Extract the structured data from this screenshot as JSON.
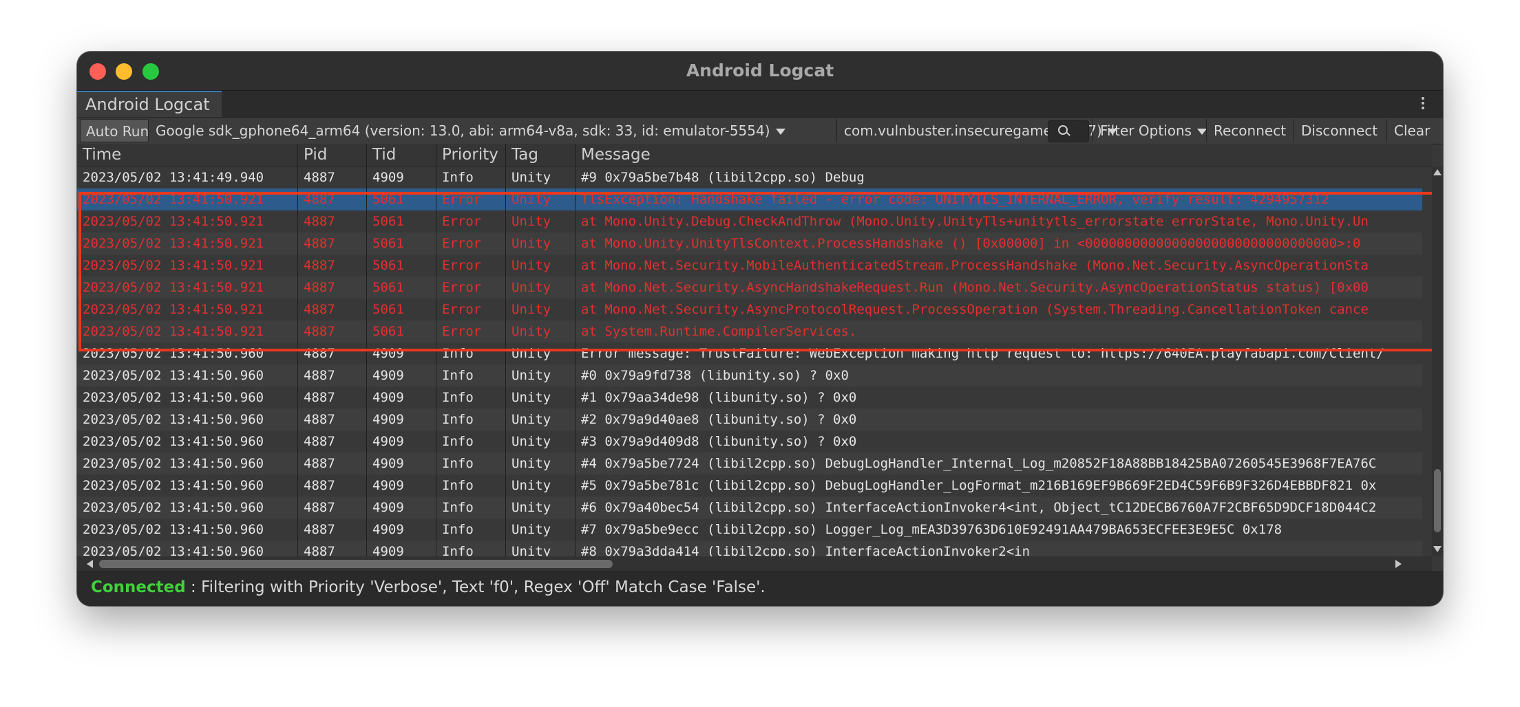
{
  "window": {
    "title": "Android Logcat",
    "tab_label": "Android Logcat"
  },
  "toolbar": {
    "auto_run": "Auto Run",
    "device": "Google sdk_gphone64_arm64 (version: 13.0, abi: arm64-v8a, sdk: 33, id: emulator-5554)",
    "package": "com.vulnbuster.insecuregame (4887)",
    "search_value": "",
    "filter_options": "Filter Options",
    "reconnect": "Reconnect",
    "disconnect": "Disconnect",
    "clear": "Clear"
  },
  "columns": [
    "Time",
    "Pid",
    "Tid",
    "Priority",
    "Tag",
    "Message"
  ],
  "rows": [
    {
      "time": "2023/05/02 13:41:49.940",
      "pid": "4887",
      "tid": "4909",
      "priority": "Info",
      "tag": "Unity",
      "message": " #9 0x79a5be7b48 (libil2cpp.so) Debug",
      "level": "info"
    },
    {
      "time": "2023/05/02 13:41:50.921",
      "pid": "4887",
      "tid": "5061",
      "priority": "Error",
      "tag": "Unity",
      "message": "TlsException: Handshake failed - error code: UNITYTLS_INTERNAL_ERROR, verify result: 4294957312",
      "level": "error",
      "selected": true
    },
    {
      "time": "2023/05/02 13:41:50.921",
      "pid": "4887",
      "tid": "5061",
      "priority": "Error",
      "tag": "Unity",
      "message": "  at Mono.Unity.Debug.CheckAndThrow (Mono.Unity.UnityTls+unitytls_errorstate errorState, Mono.Unity.Un",
      "level": "error"
    },
    {
      "time": "2023/05/02 13:41:50.921",
      "pid": "4887",
      "tid": "5061",
      "priority": "Error",
      "tag": "Unity",
      "message": "  at Mono.Unity.UnityTlsContext.ProcessHandshake () [0x00000] in <00000000000000000000000000000000>:0",
      "level": "error"
    },
    {
      "time": "2023/05/02 13:41:50.921",
      "pid": "4887",
      "tid": "5061",
      "priority": "Error",
      "tag": "Unity",
      "message": "  at Mono.Net.Security.MobileAuthenticatedStream.ProcessHandshake (Mono.Net.Security.AsyncOperationSta",
      "level": "error"
    },
    {
      "time": "2023/05/02 13:41:50.921",
      "pid": "4887",
      "tid": "5061",
      "priority": "Error",
      "tag": "Unity",
      "message": "  at Mono.Net.Security.AsyncHandshakeRequest.Run (Mono.Net.Security.AsyncOperationStatus status) [0x00",
      "level": "error"
    },
    {
      "time": "2023/05/02 13:41:50.921",
      "pid": "4887",
      "tid": "5061",
      "priority": "Error",
      "tag": "Unity",
      "message": "  at Mono.Net.Security.AsyncProtocolRequest.ProcessOperation (System.Threading.CancellationToken cance",
      "level": "error"
    },
    {
      "time": "2023/05/02 13:41:50.921",
      "pid": "4887",
      "tid": "5061",
      "priority": "Error",
      "tag": "Unity",
      "message": "  at System.Runtime.CompilerServices.",
      "level": "error"
    },
    {
      "time": "2023/05/02 13:41:50.960",
      "pid": "4887",
      "tid": "4909",
      "priority": "Info",
      "tag": "Unity",
      "message": "Error message: TrustFailure: WebException making http request to: https://640EA.playfabapi.com/Client/",
      "level": "info"
    },
    {
      "time": "2023/05/02 13:41:50.960",
      "pid": "4887",
      "tid": "4909",
      "priority": "Info",
      "tag": "Unity",
      "message": " #0 0x79a9fd738 (libunity.so) ? 0x0",
      "level": "info"
    },
    {
      "time": "2023/05/02 13:41:50.960",
      "pid": "4887",
      "tid": "4909",
      "priority": "Info",
      "tag": "Unity",
      "message": " #1 0x79aa34de98 (libunity.so) ? 0x0",
      "level": "info"
    },
    {
      "time": "2023/05/02 13:41:50.960",
      "pid": "4887",
      "tid": "4909",
      "priority": "Info",
      "tag": "Unity",
      "message": " #2 0x79a9d40ae8 (libunity.so) ? 0x0",
      "level": "info"
    },
    {
      "time": "2023/05/02 13:41:50.960",
      "pid": "4887",
      "tid": "4909",
      "priority": "Info",
      "tag": "Unity",
      "message": " #3 0x79a9d409d8 (libunity.so) ? 0x0",
      "level": "info"
    },
    {
      "time": "2023/05/02 13:41:50.960",
      "pid": "4887",
      "tid": "4909",
      "priority": "Info",
      "tag": "Unity",
      "message": " #4 0x79a5be7724 (libil2cpp.so) DebugLogHandler_Internal_Log_m20852F18A88BB18425BA07260545E3968F7EA76C",
      "level": "info"
    },
    {
      "time": "2023/05/02 13:41:50.960",
      "pid": "4887",
      "tid": "4909",
      "priority": "Info",
      "tag": "Unity",
      "message": " #5 0x79a5be781c (libil2cpp.so) DebugLogHandler_LogFormat_m216B169EF9B669F2ED4C59F6B9F326D4EBBDF821 0x",
      "level": "info"
    },
    {
      "time": "2023/05/02 13:41:50.960",
      "pid": "4887",
      "tid": "4909",
      "priority": "Info",
      "tag": "Unity",
      "message": " #6 0x79a40bec54 (libil2cpp.so) InterfaceActionInvoker4<int, Object_tC12DECB6760A7F2CBF65D9DCF18D044C2",
      "level": "info"
    },
    {
      "time": "2023/05/02 13:41:50.960",
      "pid": "4887",
      "tid": "4909",
      "priority": "Info",
      "tag": "Unity",
      "message": " #7 0x79a5be9ecc (libil2cpp.so) Logger_Log_mEA3D39763D610E92491AA479BA653ECFEE3E9E5C 0x178",
      "level": "info"
    },
    {
      "time": "2023/05/02 13:41:50.960",
      "pid": "4887",
      "tid": "4909",
      "priority": "Info",
      "tag": "Unity",
      "message": " #8 0x79a3dda414 (libil2cpp.so) InterfaceActionInvoker2<in",
      "level": "info"
    }
  ],
  "status": {
    "connected": "Connected",
    "text": " : Filtering with Priority 'Verbose', Text 'f0', Regex 'Off' Match Case 'False'."
  },
  "colors": {
    "error_text": "#e23030",
    "highlight_box": "#e8391e",
    "selected_row": "#2d5b8c",
    "connected": "#3fd23a"
  }
}
